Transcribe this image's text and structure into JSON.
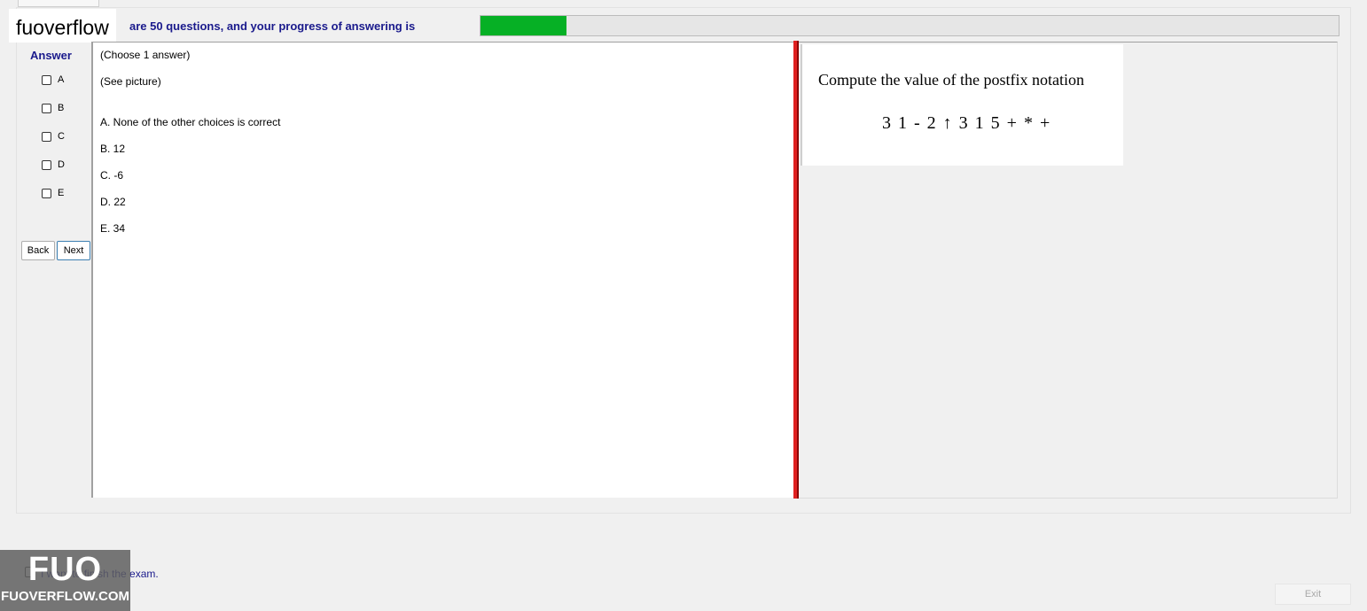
{
  "brand": {
    "name": "fuoverflow"
  },
  "progress": {
    "text": "are 50 questions, and your progress of answering is",
    "fraction": 0.1,
    "fill_color": "#06b025"
  },
  "answer_panel": {
    "title": "Answer",
    "options": [
      {
        "label": "A",
        "checked": false
      },
      {
        "label": "B",
        "checked": false
      },
      {
        "label": "C",
        "checked": false
      },
      {
        "label": "D",
        "checked": false
      },
      {
        "label": "E",
        "checked": false
      }
    ],
    "back_label": "Back",
    "next_label": "Next"
  },
  "question": {
    "instruction": "(Choose 1 answer)",
    "prompt": "(See picture)",
    "choices": [
      "A.  None of the other choices is correct",
      "B.  12",
      "C.  -6",
      "D.  22",
      "E.  34"
    ]
  },
  "picture": {
    "title": "Compute the value of the postfix notation",
    "expression": "3  1 - 2 ↑ 3  1  5 + * +"
  },
  "footer": {
    "finish_text": "I want to finish the exam.",
    "exit_label": "Exit"
  },
  "watermark": {
    "big": "FUO",
    "small": "FUOVERFLOW.COM"
  },
  "colors": {
    "splitter": "#e02020",
    "label_blue": "#1a1a8c"
  }
}
